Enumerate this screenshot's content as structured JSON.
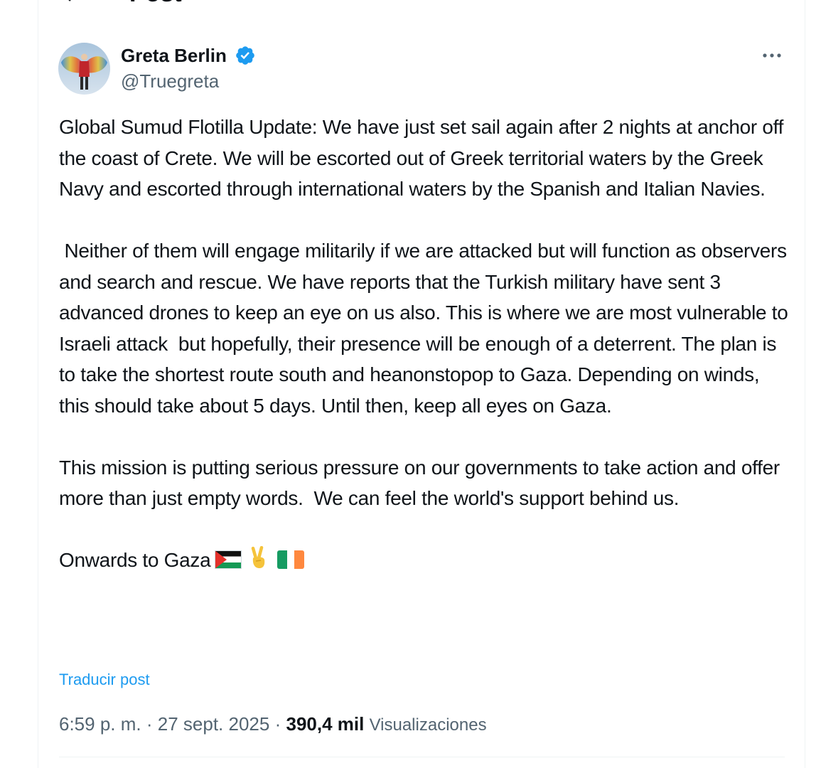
{
  "header": {
    "title": "Post"
  },
  "post": {
    "author_name": "Greta Berlin",
    "author_handle": "@Truegreta",
    "paragraphs": [
      "Global Sumud Flotilla Update: We have just set sail again after 2 nights at anchor off the coast of Crete. We will be escorted out of Greek territorial waters by the Greek Navy and escorted through international waters by the Spanish and Italian Navies.",
      " Neither of them will engage militarily if we are attacked but will function as observers and search and rescue. We have reports that the Turkish military have sent 3 advanced drones to keep an eye on us also. This is where we are most vulnerable to Israeli attack  but hopefully, their presence will be enough of a deterrent. The plan is to take the shortest route south and heanonstopop to Gaza. Depending on winds, this should take about 5 days. Until then, keep all eyes on Gaza.",
      "This mission is putting serious pressure on our governments to take action and offer more than just empty words.  We can feel the world's support behind us."
    ],
    "closing_line": "Onwards to Gaza",
    "emoji_icons": [
      "palestine-flag-icon",
      "victory-hand-icon",
      "ireland-flag-icon"
    ],
    "translate_label": "Traducir post",
    "time": "6:59 p. m.",
    "separator": "·",
    "date": "27 sept. 2025",
    "views_count": "390,4 mil",
    "views_label": "Visualizaciones"
  },
  "colors": {
    "text": "#0f1419",
    "secondary": "#536471",
    "link": "#1d9bf0",
    "verified": "#1d9bf0",
    "divider": "#eff3f4"
  }
}
